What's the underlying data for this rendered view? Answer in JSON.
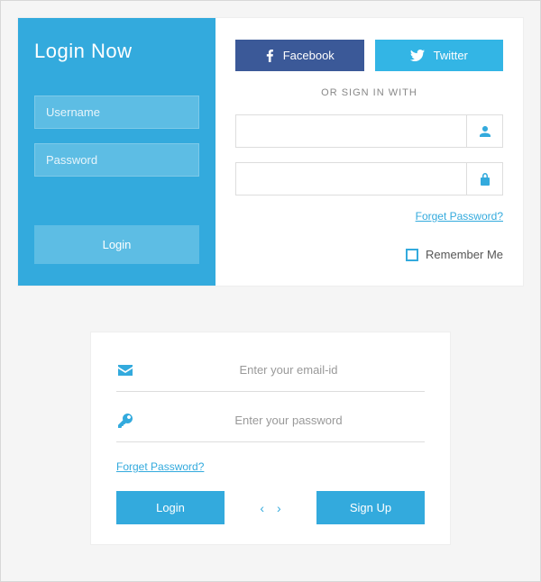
{
  "card1": {
    "left": {
      "title": "Login Now",
      "username_placeholder": "Username",
      "password_placeholder": "Password",
      "login_label": "Login"
    },
    "right": {
      "facebook_label": "Facebook",
      "twitter_label": "Twitter",
      "divider": "OR SIGN IN WITH",
      "forget_label": "Forget Password?",
      "remember_label": "Remember Me"
    }
  },
  "card2": {
    "email_placeholder": "Enter your email-id",
    "password_placeholder": "Enter your password",
    "forget_label": "Forget Password?",
    "login_label": "Login",
    "signup_label": "Sign Up",
    "prev": "‹",
    "next": "›"
  }
}
